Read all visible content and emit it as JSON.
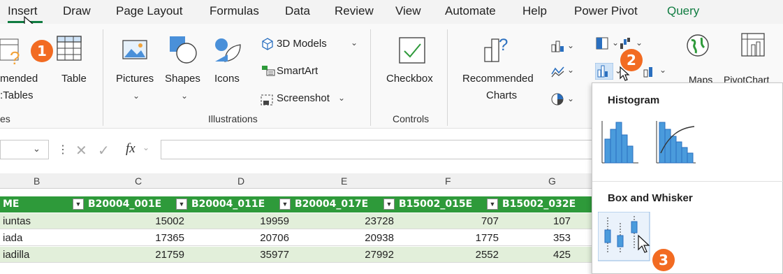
{
  "menu": {
    "tabs": [
      "Insert",
      "Draw",
      "Page Layout",
      "Formulas",
      "Data",
      "Review",
      "View",
      "Automate",
      "Help",
      "Power Pivot",
      "Query"
    ],
    "active": "Insert"
  },
  "ribbon": {
    "recommended_tables": [
      "mended",
      ":Tables"
    ],
    "table": "Table",
    "pictures": "Pictures",
    "shapes": "Shapes",
    "icons": "Icons",
    "models_3d": "3D Models",
    "smartart": "SmartArt",
    "screenshot": "Screenshot",
    "checkbox": "Checkbox",
    "recommended_charts": [
      "Recommended",
      "Charts"
    ],
    "maps": "Maps",
    "pivotchart": "PivotChart",
    "groups": {
      "tables": "es",
      "illustrations": "Illustrations",
      "controls": "Controls"
    }
  },
  "formula_bar": {
    "fx": "fx"
  },
  "grid": {
    "col_letters": [
      "B",
      "C",
      "D",
      "E",
      "F",
      "G"
    ],
    "headers": [
      "ME",
      "B20004_001E",
      "B20004_011E",
      "B20004_017E",
      "B15002_015E",
      "B15002_032E"
    ],
    "rows": [
      [
        "iuntas",
        "15002",
        "19959",
        "23728",
        "707",
        "107"
      ],
      [
        "iada",
        "17365",
        "20706",
        "20938",
        "1775",
        "353"
      ],
      [
        "iadilla",
        "21759",
        "35977",
        "27992",
        "2552",
        "425"
      ]
    ]
  },
  "panel": {
    "histogram": "Histogram",
    "box_whisker": "Box and Whisker"
  },
  "badges": [
    "1",
    "2",
    "3"
  ],
  "colors": {
    "accent": "#107c41",
    "header_green": "#2e9a3a",
    "badge": "#f26b22",
    "row_alt": "#e2efda"
  }
}
